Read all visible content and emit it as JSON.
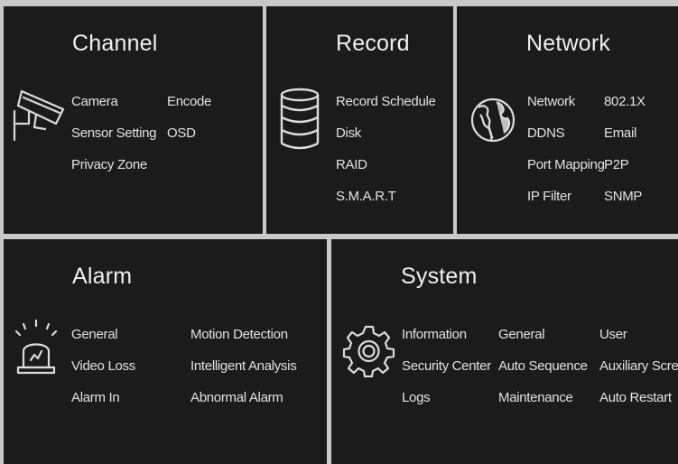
{
  "channel": {
    "title": "Channel",
    "icon": "camera-icon",
    "items": [
      "Camera",
      "Encode",
      "Sensor Setting",
      "OSD",
      "Privacy Zone"
    ]
  },
  "record": {
    "title": "Record",
    "icon": "database-icon",
    "items": [
      "Record Schedule",
      "Disk",
      "RAID",
      "S.M.A.R.T"
    ]
  },
  "network": {
    "title": "Network",
    "icon": "globe-icon",
    "items": [
      "Network",
      "802.1X",
      "DDNS",
      "Email",
      "Port Mapping",
      "P2P",
      "IP Filter",
      "SNMP"
    ]
  },
  "alarm": {
    "title": "Alarm",
    "icon": "alarm-siren-icon",
    "items": [
      "General",
      "Motion Detection",
      "Video Loss",
      "Intelligent Analysis",
      "Alarm In",
      "Abnormal Alarm"
    ]
  },
  "system": {
    "title": "System",
    "icon": "gear-icon",
    "items": [
      "Information",
      "General",
      "User",
      "Security Center",
      "Auto Sequence",
      "Auxiliary Scre",
      "Logs",
      "Maintenance",
      "Auto Restart"
    ]
  },
  "colors": {
    "panel": "#1b1b1b",
    "gap": "#c9c9c9",
    "text": "#e2e2e2",
    "icon": "#dcdcdc"
  }
}
